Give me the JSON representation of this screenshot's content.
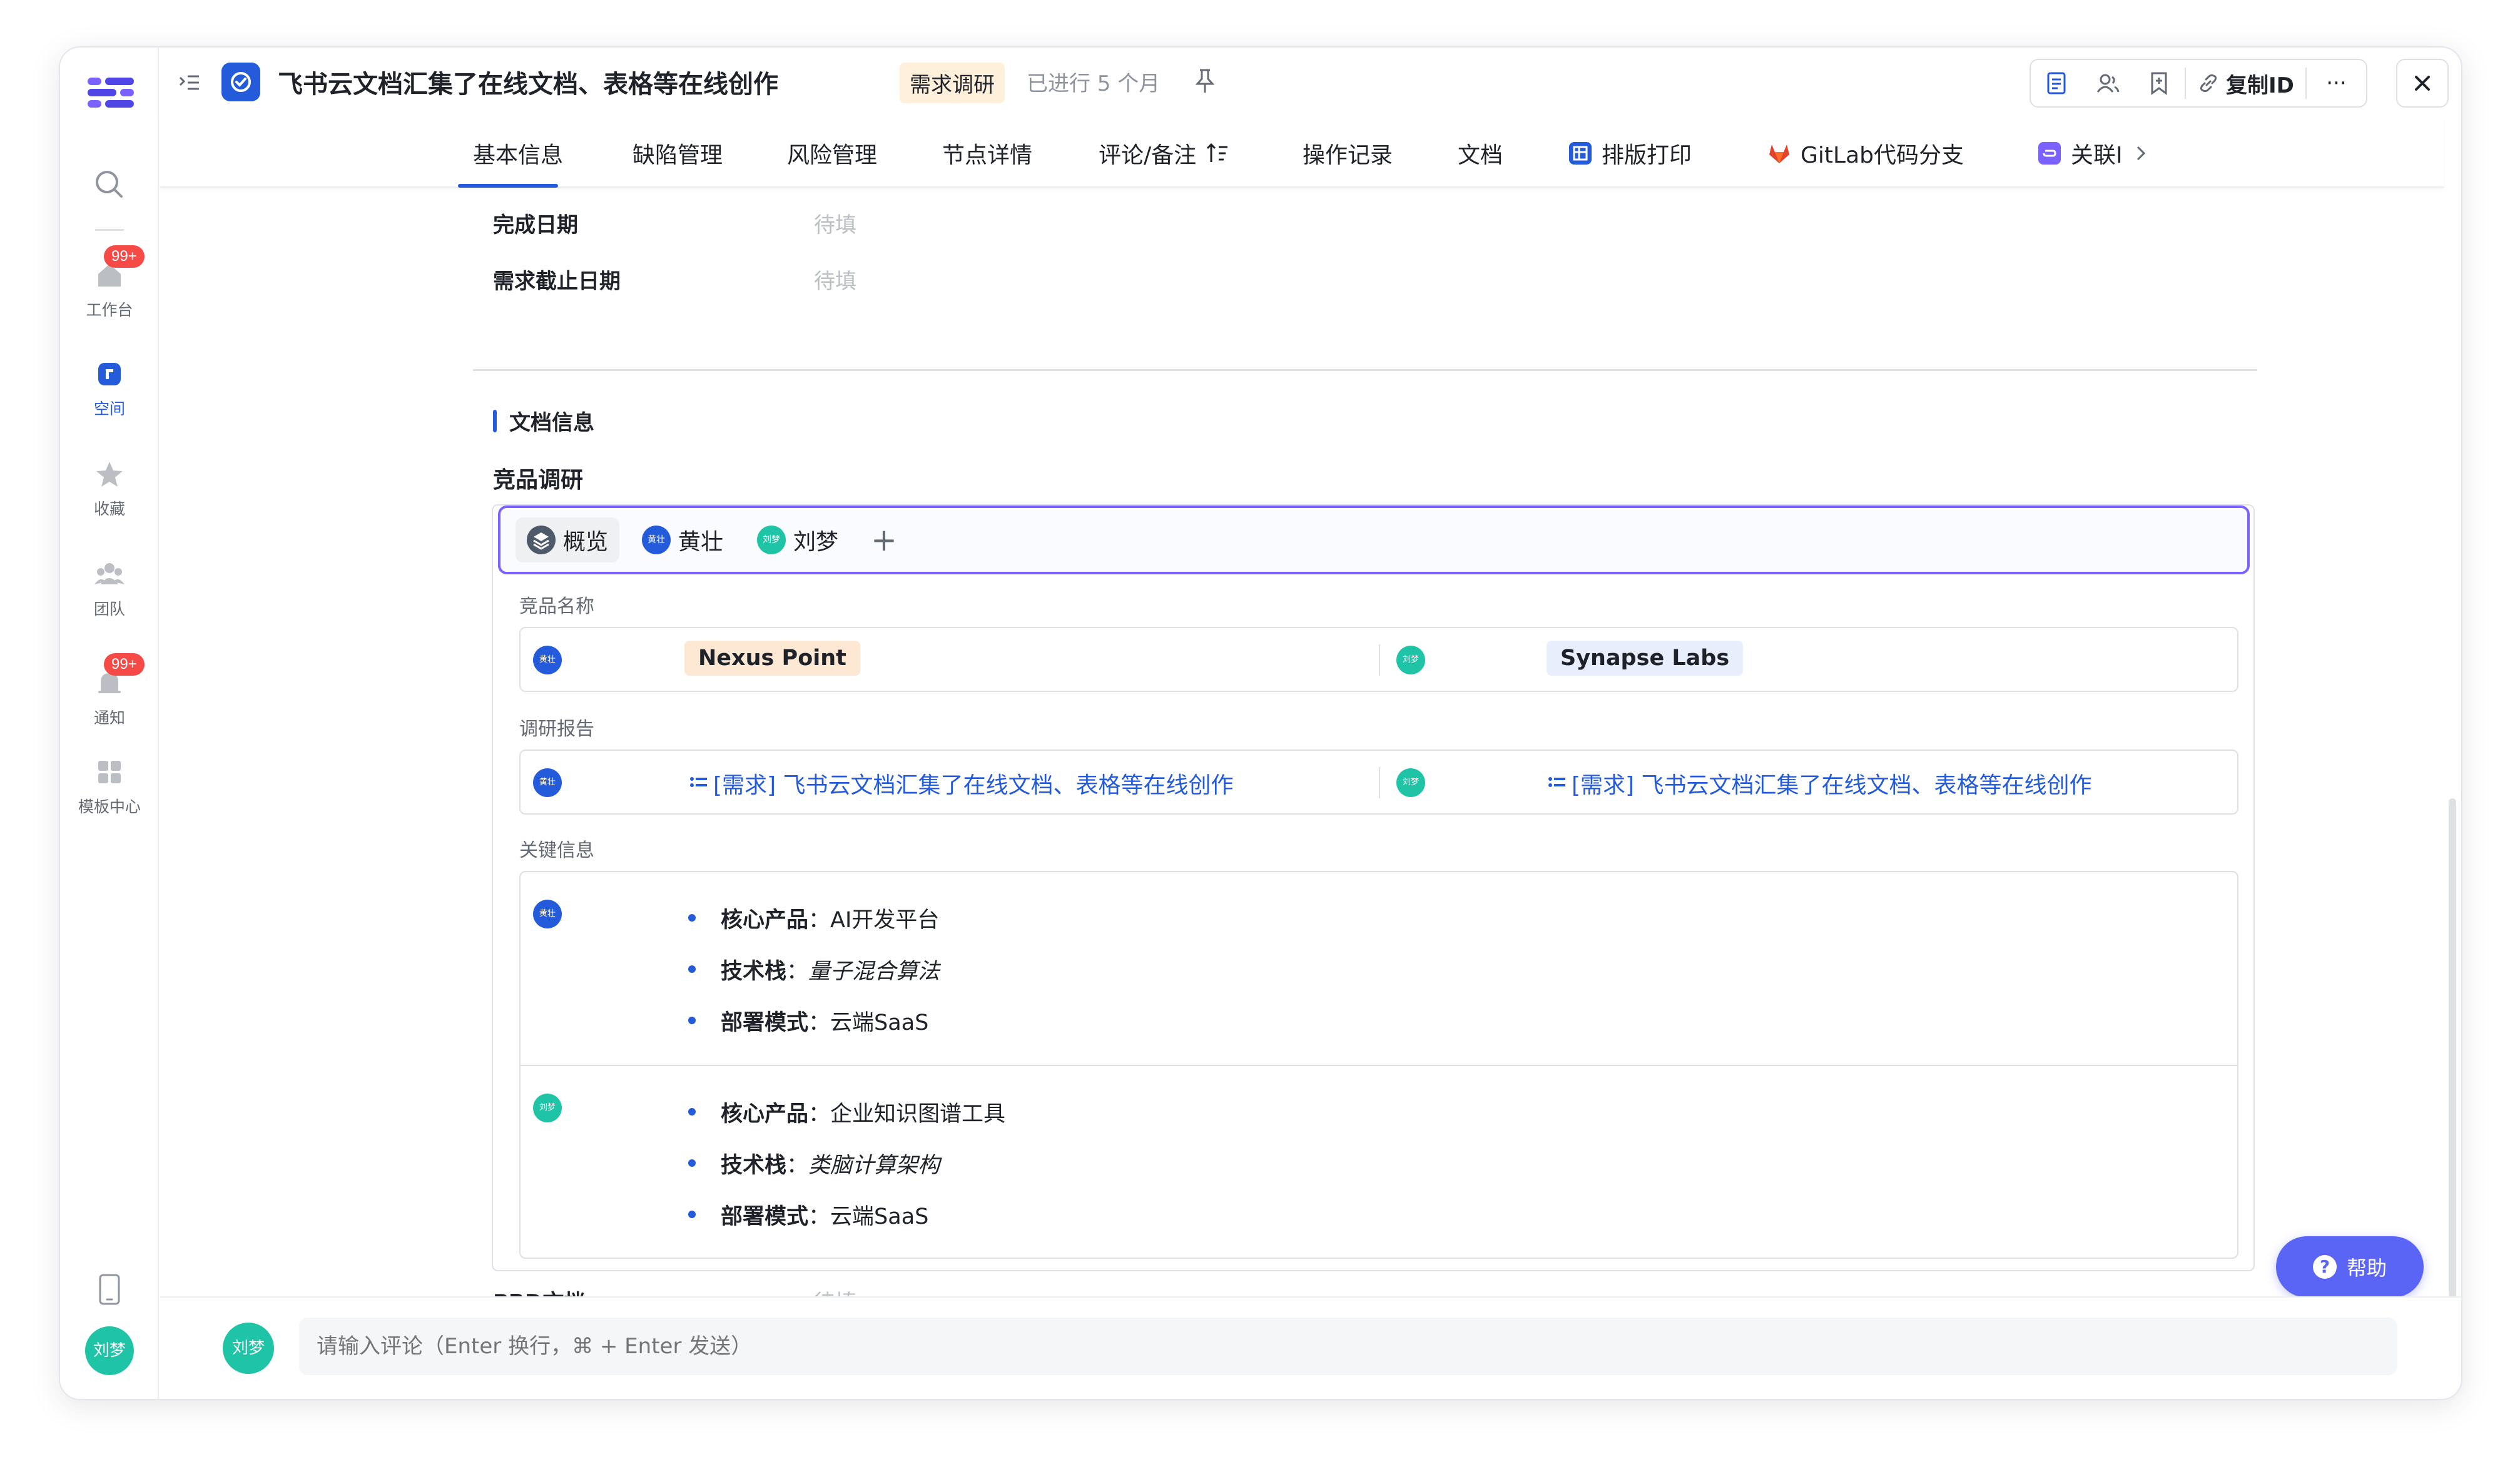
{
  "rail": {
    "items": [
      {
        "label": "工作台",
        "badge": "99+"
      },
      {
        "label": "空间"
      },
      {
        "label": "收藏"
      },
      {
        "label": "团队"
      },
      {
        "label": "通知",
        "badge": "99+"
      },
      {
        "label": "模板中心"
      }
    ],
    "user_avatar": "刘梦"
  },
  "header": {
    "title": "飞书云文档汇集了在线文档、表格等在线创作",
    "stage": "需求调研",
    "elapsed": "已进行 5 个月",
    "copy_id_label": "复制ID",
    "more_label": "···"
  },
  "tabs": [
    {
      "label": "基本信息"
    },
    {
      "label": "缺陷管理"
    },
    {
      "label": "风险管理"
    },
    {
      "label": "节点详情"
    },
    {
      "label": "评论/备注"
    },
    {
      "label": "操作记录"
    },
    {
      "label": "文档"
    },
    {
      "label": "排版打印"
    },
    {
      "label": "GitLab代码分支"
    },
    {
      "label": "关联I"
    }
  ],
  "fields": {
    "complete_date": {
      "label": "完成日期",
      "value": "待填"
    },
    "deadline": {
      "label": "需求截止日期",
      "value": "待填"
    },
    "prd": {
      "label": "PRD文档",
      "value": "待填"
    }
  },
  "doc_section": {
    "title": "文档信息",
    "subsection": "竞品调研",
    "chips": [
      {
        "label": "概览"
      },
      {
        "label": "黄壮",
        "avatar": "黄壮"
      },
      {
        "label": "刘梦",
        "avatar": "刘梦"
      }
    ],
    "add_label": "+",
    "groups": {
      "product_name": {
        "label": "竞品名称",
        "left": {
          "avatar": "黄壮",
          "value": "Nexus Point"
        },
        "right": {
          "avatar": "刘梦",
          "value": "Synapse Labs"
        }
      },
      "report": {
        "label": "调研报告",
        "left": {
          "avatar": "黄壮",
          "value": "[需求] 飞书云文档汇集了在线文档、表格等在线创作"
        },
        "right": {
          "avatar": "刘梦",
          "value": "[需求] 飞书云文档汇集了在线文档、表格等在线创作"
        }
      },
      "key_info": {
        "label": "关键信息",
        "entries": [
          {
            "avatar": "黄壮",
            "items": [
              {
                "k": "核心产品",
                "v": "AI开发平台"
              },
              {
                "k": "技术栈",
                "v": "量子混合算法"
              },
              {
                "k": "部署模式",
                "v": "云端SaaS"
              }
            ]
          },
          {
            "avatar": "刘梦",
            "items": [
              {
                "k": "核心产品",
                "v": "企业知识图谱工具"
              },
              {
                "k": "技术栈",
                "v": "类脑计算架构"
              },
              {
                "k": "部署模式",
                "v": "云端SaaS"
              }
            ]
          }
        ]
      }
    }
  },
  "help_label": "帮助",
  "comment": {
    "avatar": "刘梦",
    "placeholder": "请输入评论（Enter 换行，⌘ + Enter 发送）"
  },
  "colors": {
    "primary": "#245bdb",
    "accent_purple": "#7b61ff",
    "stage_tag_bg": "#fff0db",
    "name_tag_left_bg": "#fde8d3",
    "name_tag_right_bg": "#e8eefc",
    "avatar_green": "#1ec4a5",
    "badge_red": "#f54a45"
  }
}
